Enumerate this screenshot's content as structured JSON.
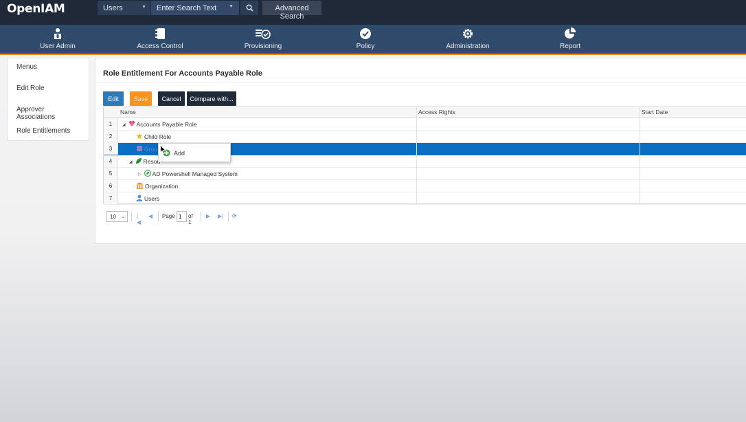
{
  "app": {
    "logo_text": "OpenIAM"
  },
  "search": {
    "type_value": "Users",
    "placeholder": "Enter Search Text",
    "advanced_label": "Advanced Search"
  },
  "nav": {
    "items": [
      {
        "label": "User Admin",
        "icon": "user-admin-icon"
      },
      {
        "label": "Access Control",
        "icon": "access-control-icon"
      },
      {
        "label": "Provisioning",
        "icon": "provisioning-icon"
      },
      {
        "label": "Policy",
        "icon": "policy-icon"
      },
      {
        "label": "Administration",
        "icon": "gear-icon"
      },
      {
        "label": "Report",
        "icon": "report-icon"
      }
    ]
  },
  "side": {
    "items": [
      {
        "label": "Menus"
      },
      {
        "label": "Edit Role"
      },
      {
        "label": "Approver Associations"
      },
      {
        "label": "Role Entitlements"
      }
    ]
  },
  "main": {
    "title": "Role Entitlement For Accounts Payable Role",
    "buttons": {
      "edit": "Edit",
      "save": "Save",
      "cancel": "Cancel",
      "compare": "Compare with..."
    },
    "grid": {
      "columns": [
        "Name",
        "Access Rights",
        "Start Date"
      ],
      "rows": [
        {
          "num": "1",
          "name": "Accounts Payable Role",
          "icon": "role-icon"
        },
        {
          "num": "2",
          "name": "Child Role",
          "icon": "star-icon"
        },
        {
          "num": "3",
          "name": "Grou",
          "icon": "group-icon",
          "selected": true
        },
        {
          "num": "4",
          "name": "Resou",
          "icon": "resource-leaf-icon"
        },
        {
          "num": "5",
          "name": "AD Powershell Managed System",
          "icon": "managed-system-icon"
        },
        {
          "num": "6",
          "name": "Organization",
          "icon": "organization-icon"
        },
        {
          "num": "7",
          "name": "Users",
          "icon": "user-icon"
        }
      ]
    },
    "context_menu": {
      "add_label": "Add"
    },
    "pager": {
      "page_size": "10",
      "page_label": "Page",
      "page_value": "1",
      "of_label": "of 1"
    }
  },
  "colors": {
    "topbar": "#1f2937",
    "nav": "#2f4a6b",
    "accent": "#f08c1a",
    "selected_row": "#0a6fc2",
    "save_button": "#f7941d",
    "edit_button": "#2f79b9"
  }
}
